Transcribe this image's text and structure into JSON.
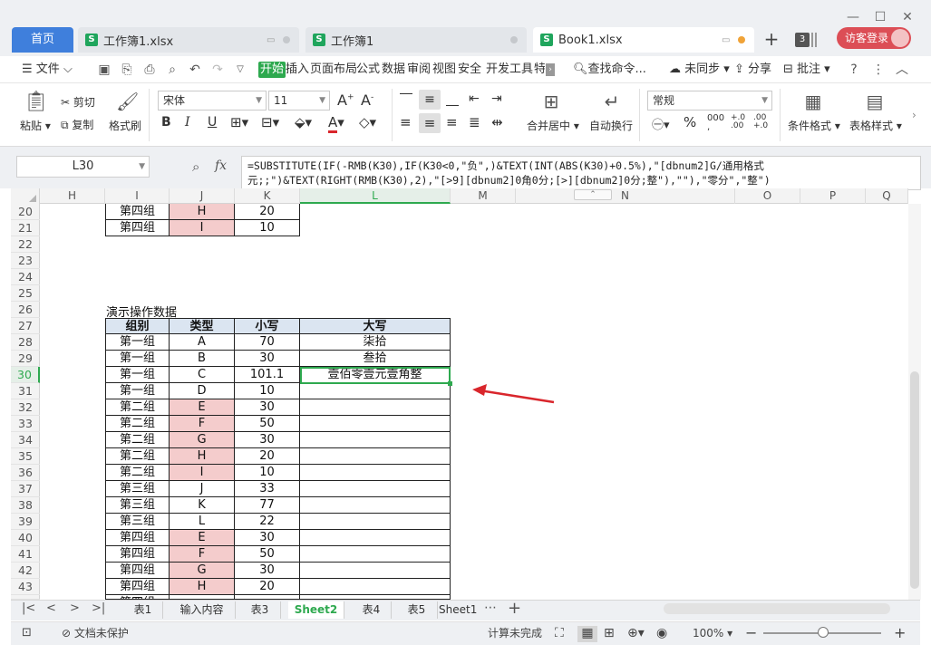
{
  "tabs": {
    "home": "首页",
    "docs": [
      {
        "title": "工作簿1.xlsx"
      },
      {
        "title": "工作簿1"
      },
      {
        "title": "Book1.xlsx"
      }
    ],
    "count": "3",
    "visitor": "访客登录"
  },
  "menu": {
    "file": "文件",
    "items": [
      "开始",
      "插入",
      "页面布局",
      "公式",
      "数据",
      "审阅",
      "视图",
      "安全",
      "开发工具",
      "特"
    ],
    "search": "查找命令...",
    "sync": "未同步",
    "share": "分享",
    "comment": "批注"
  },
  "ribbon": {
    "paste": "粘贴",
    "cut": "剪切",
    "copy": "复制",
    "format_painter": "格式刷",
    "font_name": "宋体",
    "font_size": "11",
    "merge_center": "合并居中",
    "wrap": "自动换行",
    "number_format": "常规",
    "cond_format": "条件格式",
    "table_style": "表格样式"
  },
  "formula_bar": {
    "name_box": "L30",
    "fx": "fx",
    "formula": "=SUBSTITUTE(IF(-RMB(K30),IF(K30<0,\"负\",)&TEXT(INT(ABS(K30)+0.5%),\"[dbnum2]G/通用格式\n元;;\")&TEXT(RIGHT(RMB(K30),2),\"[>9][dbnum2]0角0分;[>][dbnum2]0分;整\"),\"\"),\"零分\",\"整\")"
  },
  "columns": [
    "H",
    "I",
    "J",
    "K",
    "L",
    "M",
    "N",
    "O",
    "P",
    "Q"
  ],
  "rows": {
    "numbers": [
      "20",
      "21",
      "22",
      "23",
      "24",
      "25",
      "26",
      "27",
      "28",
      "29",
      "30",
      "31",
      "32",
      "33",
      "34",
      "35",
      "36",
      "37",
      "38",
      "39",
      "40",
      "41",
      "42",
      "43",
      "44"
    ],
    "selected": "30"
  },
  "top_table": [
    {
      "group": "第四组",
      "type": "H",
      "value": "20"
    },
    {
      "group": "第四组",
      "type": "I",
      "value": "10"
    }
  ],
  "demo_title": "演示操作数据",
  "table_headers": [
    "组别",
    "类型",
    "小写",
    "大写"
  ],
  "table_rows": [
    {
      "group": "第一组",
      "type": "A",
      "value": "70",
      "upper": "柒拾"
    },
    {
      "group": "第一组",
      "type": "B",
      "value": "30",
      "upper": "叁拾"
    },
    {
      "group": "第一组",
      "type": "C",
      "value": "101.1",
      "upper": "壹佰零壹元壹角整"
    },
    {
      "group": "第一组",
      "type": "D",
      "value": "10",
      "upper": ""
    },
    {
      "group": "第二组",
      "type": "E",
      "value": "30",
      "upper": ""
    },
    {
      "group": "第二组",
      "type": "F",
      "value": "50",
      "upper": ""
    },
    {
      "group": "第二组",
      "type": "G",
      "value": "30",
      "upper": ""
    },
    {
      "group": "第二组",
      "type": "H",
      "value": "20",
      "upper": ""
    },
    {
      "group": "第二组",
      "type": "I",
      "value": "10",
      "upper": ""
    },
    {
      "group": "第三组",
      "type": "J",
      "value": "33",
      "upper": ""
    },
    {
      "group": "第三组",
      "type": "K",
      "value": "77",
      "upper": ""
    },
    {
      "group": "第三组",
      "type": "L",
      "value": "22",
      "upper": ""
    },
    {
      "group": "第四组",
      "type": "E",
      "value": "30",
      "upper": ""
    },
    {
      "group": "第四组",
      "type": "F",
      "value": "50",
      "upper": ""
    },
    {
      "group": "第四组",
      "type": "G",
      "value": "30",
      "upper": ""
    },
    {
      "group": "第四组",
      "type": "H",
      "value": "20",
      "upper": ""
    },
    {
      "group": "第四组",
      "type": "",
      "value": "",
      "upper": ""
    }
  ],
  "pink_types": [
    "E",
    "F",
    "G",
    "H",
    "I"
  ],
  "sheets": [
    "表1",
    "输入内容",
    "表3",
    "Sheet2",
    "表4",
    "表5",
    "Sheet1"
  ],
  "active_sheet": "Sheet2",
  "status": {
    "protect": "文档未保护",
    "calc": "计算未完成",
    "zoom": "100%"
  },
  "colors": {
    "accent": "#2ea94f",
    "home_tab": "#3f7fdc",
    "visitor": "#dc4e56",
    "arrow": "#d9262c",
    "header_fill": "#dbe5f1",
    "pink_fill": "#f4cccc"
  }
}
